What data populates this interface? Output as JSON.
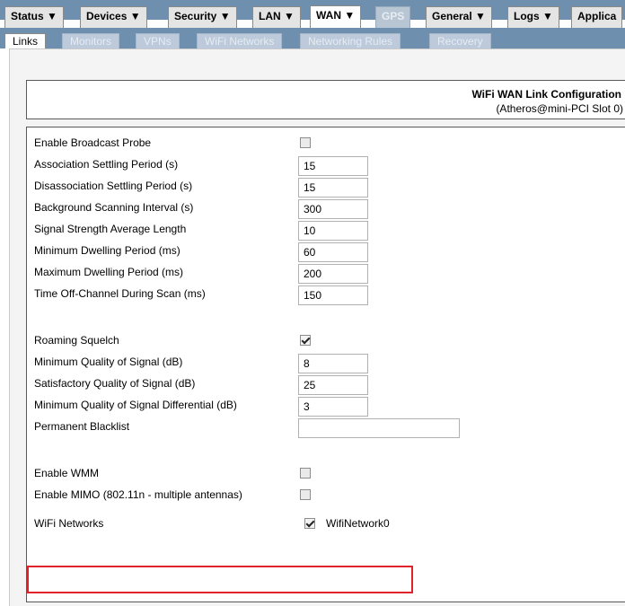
{
  "menu": {
    "tabs": [
      {
        "label": "Status ▼"
      },
      {
        "label": "Devices ▼"
      },
      {
        "label": "Security ▼"
      },
      {
        "label": "LAN ▼"
      },
      {
        "label": "WAN ▼"
      },
      {
        "label": "GPS"
      },
      {
        "label": "General ▼"
      },
      {
        "label": "Logs ▼"
      },
      {
        "label": "Applica"
      }
    ],
    "active": "WAN ▼"
  },
  "submenu": {
    "tabs": [
      {
        "label": "Links"
      },
      {
        "label": "Monitors"
      },
      {
        "label": "VPNs"
      },
      {
        "label": "WiFi Networks"
      },
      {
        "label": "Networking Rules"
      },
      {
        "label": "Recovery"
      }
    ],
    "active": "Links"
  },
  "header": {
    "title": "WiFi WAN Link Configuration",
    "subtitle": "(Atheros@mini-PCI Slot 0)"
  },
  "form": {
    "enable_broadcast_probe": {
      "label": "Enable Broadcast Probe",
      "checked": false
    },
    "association_settling": {
      "label": "Association Settling Period (s)",
      "value": "15"
    },
    "disassociation_settling": {
      "label": "Disassociation Settling Period (s)",
      "value": "15"
    },
    "background_scanning": {
      "label": "Background Scanning Interval (s)",
      "value": "300"
    },
    "signal_strength_avg": {
      "label": "Signal Strength Average Length",
      "value": "10"
    },
    "min_dwelling": {
      "label": "Minimum Dwelling Period (ms)",
      "value": "60"
    },
    "max_dwelling": {
      "label": "Maximum Dwelling Period (ms)",
      "value": "200"
    },
    "time_off_channel": {
      "label": "Time Off-Channel During Scan (ms)",
      "value": "150"
    },
    "roaming_squelch": {
      "label": "Roaming Squelch",
      "checked": true
    },
    "min_quality": {
      "label": "Minimum Quality of Signal (dB)",
      "value": "8"
    },
    "sat_quality": {
      "label": "Satisfactory Quality of Signal (dB)",
      "value": "25"
    },
    "min_quality_diff": {
      "label": "Minimum Quality of Signal Differential (dB)",
      "value": "3"
    },
    "permanent_blacklist": {
      "label": "Permanent Blacklist",
      "value": ""
    },
    "enable_wmm": {
      "label": "Enable WMM",
      "checked": false
    },
    "enable_mimo": {
      "label": "Enable MIMO (802.11n - multiple antennas)",
      "checked": false
    },
    "wifi_networks": {
      "label": "WiFi Networks",
      "option": "WifiNetwork0",
      "checked": true
    }
  },
  "colors": {
    "menubar": "#6f8faf",
    "highlight": "#e0232b"
  }
}
